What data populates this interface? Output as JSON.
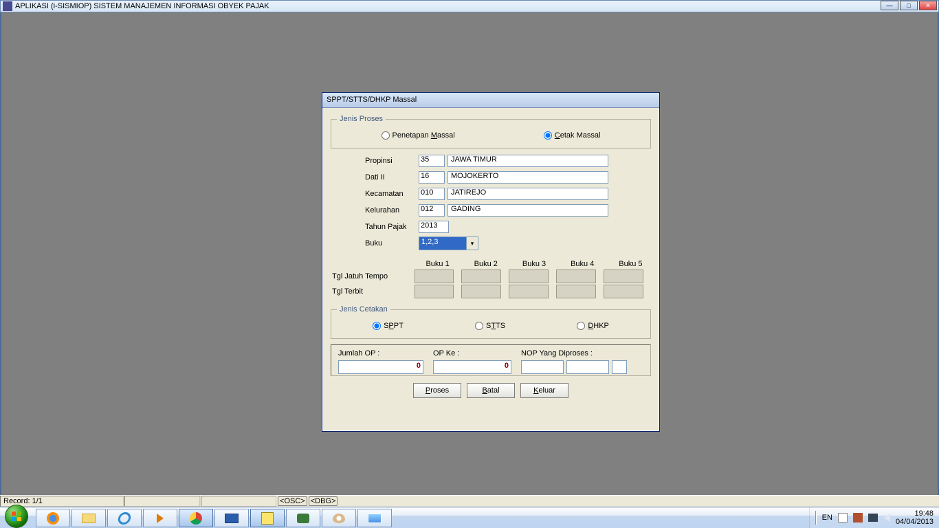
{
  "window": {
    "title": "APLIKASI (i-SISMIOP) SISTEM MANAJEMEN INFORMASI OBYEK PAJAK"
  },
  "dialog": {
    "title": "SPPT/STTS/DHKP Massal",
    "group_jenis_proses": {
      "legend": "Jenis Proses",
      "opt_penetapan": "Penetapan Massal",
      "opt_cetak": "Cetak Massal"
    },
    "fields": {
      "propinsi_lbl": "Propinsi",
      "propinsi_code": "35",
      "propinsi_name": "JAWA TIMUR",
      "dati_lbl": "Dati II",
      "dati_code": "16",
      "dati_name": "MOJOKERTO",
      "kecamatan_lbl": "Kecamatan",
      "kecamatan_code": "010",
      "kecamatan_name": "JATIREJO",
      "kelurahan_lbl": "Kelurahan",
      "kelurahan_code": "012",
      "kelurahan_name": "GADING",
      "tahun_lbl": "Tahun Pajak",
      "tahun_val": "2013",
      "buku_lbl": "Buku",
      "buku_val": "1,2,3"
    },
    "buku_headers": {
      "b1": "Buku 1",
      "b2": "Buku 2",
      "b3": "Buku 3",
      "b4": "Buku 4",
      "b5": "Buku 5"
    },
    "buku_rows": {
      "tgl_tempo": "Tgl Jatuh Tempo",
      "tgl_terbit": "Tgl Terbit"
    },
    "group_jenis_cetakan": {
      "legend": "Jenis Cetakan",
      "opt_sppt": "SPPT",
      "opt_stts": "STTS",
      "opt_dhkp": "DHKP"
    },
    "status": {
      "jumlah_lbl": "Jumlah OP :",
      "jumlah_val": "0",
      "opke_lbl": "OP Ke :",
      "opke_val": "0",
      "nop_lbl": "NOP Yang Diproses :"
    },
    "buttons": {
      "proses": "Proses",
      "batal": "Batal",
      "keluar": "Keluar"
    }
  },
  "statusbar": {
    "record": "Record: 1/1",
    "osc": "OSC",
    "dbg": "DBG"
  },
  "tray": {
    "lang": "EN",
    "time": "19:48",
    "date": "04/04/2013"
  }
}
